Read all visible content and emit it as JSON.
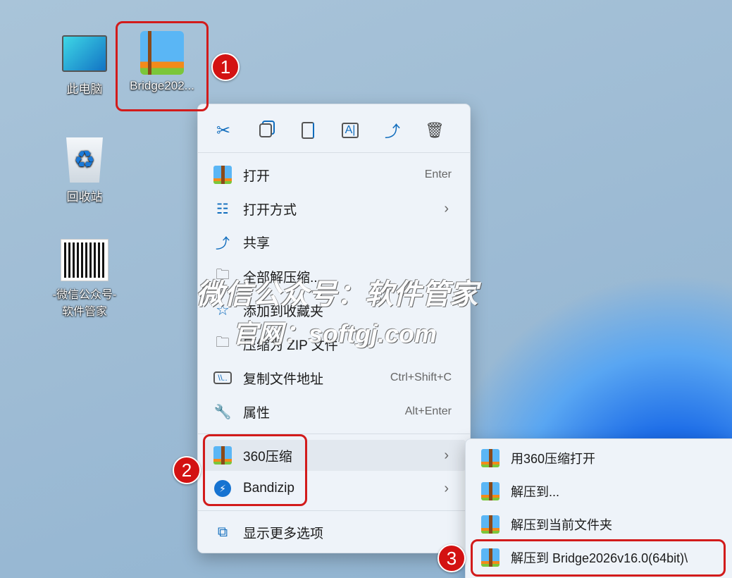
{
  "desktop": {
    "icons": [
      {
        "label": "此电脑"
      },
      {
        "label": "Bridge202..."
      },
      {
        "label": "回收站"
      },
      {
        "label": "-微信公众号-",
        "label2": "软件管家"
      }
    ]
  },
  "context_menu": {
    "toolbar": [
      "cut",
      "copy",
      "paste",
      "rename",
      "share",
      "delete"
    ],
    "items": [
      {
        "label": "打开",
        "shortcut": "Enter"
      },
      {
        "label": "打开方式"
      },
      {
        "label": "共享"
      },
      {
        "label": "全部解压缩..."
      },
      {
        "label": "添加到收藏夹"
      },
      {
        "label": "压缩为 ZIP 文件"
      },
      {
        "label": "复制文件地址",
        "shortcut": "Ctrl+Shift+C"
      },
      {
        "label": "属性",
        "shortcut": "Alt+Enter"
      },
      {
        "label": "360压缩"
      },
      {
        "label": "Bandizip"
      },
      {
        "label": "显示更多选项"
      }
    ]
  },
  "submenu": {
    "items": [
      {
        "label": "用360压缩打开"
      },
      {
        "label": "解压到..."
      },
      {
        "label": "解压到当前文件夹"
      },
      {
        "label": "解压到 Bridge2026v16.0(64bit)\\"
      }
    ]
  },
  "badges": [
    "1",
    "2",
    "3"
  ],
  "watermark": {
    "line1": "微信公众号：软件管家",
    "line2": "官网：softgj.com"
  },
  "colors": {
    "highlight": "#d21b1b",
    "accent": "#0f6cbd"
  }
}
